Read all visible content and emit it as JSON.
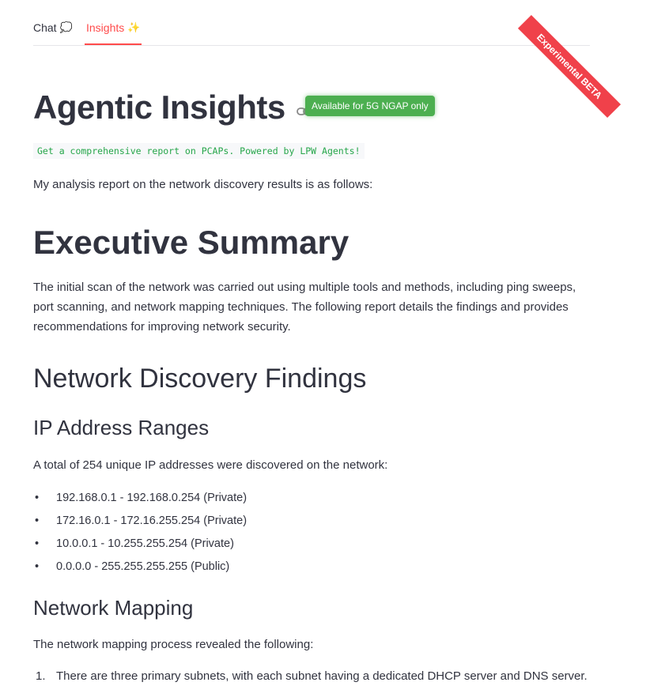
{
  "tabs": [
    {
      "label": "Chat",
      "icon": "💭"
    },
    {
      "label": "Insights",
      "icon": "✨"
    }
  ],
  "ribbon": "Experimental BETA",
  "title": "Agentic Insights",
  "badge": "Available for 5G NGAP only",
  "subtitle": "Get a comprehensive report on PCAPs. Powered by LPW Agents!",
  "intro": "My analysis report on the network discovery results is as follows:",
  "sections": {
    "exec_heading": "Executive Summary",
    "exec_text": "The initial scan of the network was carried out using multiple tools and methods, including ping sweeps, port scanning, and network mapping techniques. The following report details the findings and provides recommendations for improving network security.",
    "findings_heading": "Network Discovery Findings",
    "ip_heading": "IP Address Ranges",
    "ip_text": "A total of 254 unique IP addresses were discovered on the network:",
    "ip_ranges": [
      "192.168.0.1 - 192.168.0.254 (Private)",
      "172.16.0.1 - 172.16.255.254 (Private)",
      "10.0.0.1 - 10.255.255.254 (Private)",
      "0.0.0.0 - 255.255.255.255 (Public)"
    ],
    "mapping_heading": "Network Mapping",
    "mapping_text": "The network mapping process revealed the following:",
    "mapping_items": [
      {
        "num": "1.",
        "text": "There are three primary subnets, with each subnet having a dedicated DHCP server and DNS server."
      }
    ]
  },
  "colors": {
    "accent": "#ff4b4b",
    "badge": "#4caf50",
    "ribbon": "#f0414a",
    "code": "#26a64a"
  }
}
